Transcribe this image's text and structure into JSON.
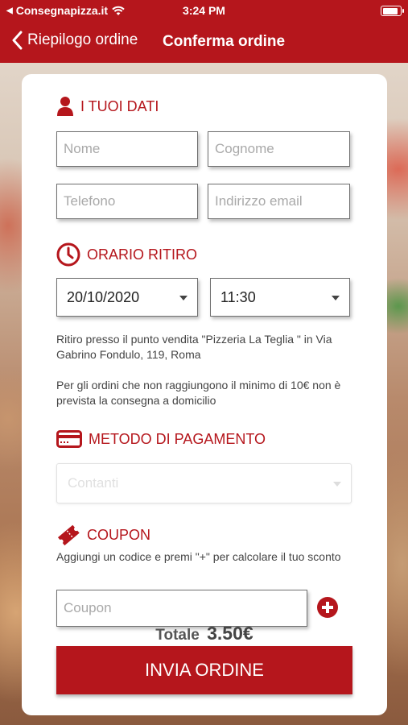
{
  "status_bar": {
    "back_app": "Consegnapizza.it",
    "time": "3:24 PM"
  },
  "nav": {
    "back_label": "Riepilogo ordine",
    "title": "Conferma ordine"
  },
  "dati": {
    "heading": "I TUOI DATI",
    "nome_placeholder": "Nome",
    "cognome_placeholder": "Cognome",
    "telefono_placeholder": "Telefono",
    "email_placeholder": "Indirizzo email"
  },
  "orario": {
    "heading": "ORARIO RITIRO",
    "date_value": "20/10/2020",
    "time_value": "11:30",
    "pickup_info": "Ritiro presso il punto vendita \"Pizzeria La Teglia \" in Via Gabrino Fondulo, 119, Roma",
    "min_order_info": "Per gli ordini che non raggiungono il minimo di 10€ non è prevista la consegna a domicilio"
  },
  "pagamento": {
    "heading": "METODO DI PAGAMENTO",
    "selected": "Contanti"
  },
  "coupon": {
    "heading": "COUPON",
    "help": "Aggiungi un codice e premi \"+\" per calcolare il tuo sconto",
    "placeholder": "Coupon"
  },
  "totale": {
    "label": "Totale",
    "amount": "3.50€"
  },
  "submit_label": "INVIA ORDINE",
  "colors": {
    "accent": "#b5161c"
  },
  "icons": [
    "back-arrow-icon",
    "wifi-icon",
    "battery-icon",
    "user-icon",
    "clock-icon",
    "credit-card-icon",
    "ticket-icon",
    "plus-circle-icon"
  ]
}
